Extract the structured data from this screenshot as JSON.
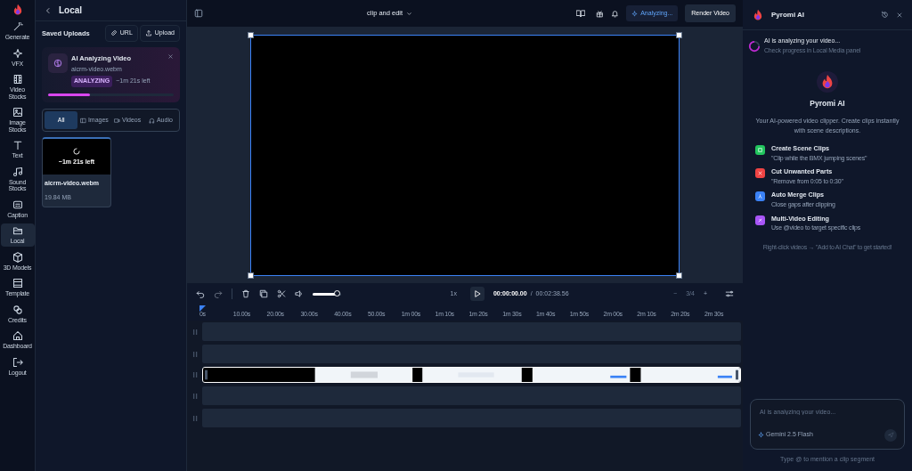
{
  "rail": {
    "items": [
      {
        "label": "Generate",
        "selected": false
      },
      {
        "label": "VFX",
        "selected": false
      },
      {
        "label": "Video Stocks",
        "selected": false
      },
      {
        "label": "Image Stocks",
        "selected": false
      },
      {
        "label": "Text",
        "selected": false
      },
      {
        "label": "Sound Stocks",
        "selected": false
      },
      {
        "label": "Caption",
        "selected": false
      },
      {
        "label": "Local",
        "selected": true
      },
      {
        "label": "3D Models",
        "selected": false
      },
      {
        "label": "Template",
        "selected": false
      },
      {
        "label": "Credits",
        "selected": false
      },
      {
        "label": "Dashboard",
        "selected": false
      },
      {
        "label": "Logout",
        "selected": false
      }
    ]
  },
  "panel": {
    "title": "Local",
    "section": "Saved Uploads",
    "buttons": [
      "URL",
      "Upload"
    ],
    "analysis": {
      "title": "AI Analyzing Video",
      "file": "aicrm-video.webm",
      "badge": "ANALYZING",
      "remaining": "~1m 21s left",
      "level": 0.33
    },
    "filters": [
      {
        "label": "All",
        "selected": true
      },
      {
        "label": "Images",
        "selected": false
      },
      {
        "label": "Videos",
        "selected": false
      },
      {
        "label": "Audio",
        "selected": false
      }
    ],
    "media": [
      {
        "name": "aicrm-video.webm",
        "size": "19.84 MB",
        "overlay": "~1m 21s left",
        "selected": true
      }
    ]
  },
  "header": {
    "project": "clip and edit",
    "status": "Analyzing...",
    "render": "Render Video"
  },
  "controls": {
    "volume": {
      "level": 0.85
    },
    "speed": "1x",
    "time": "00:00:00.00",
    "separator": "/",
    "duration": "00:02:38.56",
    "zoom_out": "−",
    "zoom": "3/4",
    "zoom_in": "+"
  },
  "ruler": [
    "0s",
    "10.00s",
    "20.00s",
    "30.00s",
    "40.00s",
    "50.00s",
    "1m 00s",
    "1m 10s",
    "1m 20s",
    "1m 30s",
    "1m 40s",
    "1m 50s",
    "2m 00s",
    "2m 10s",
    "2m 20s",
    "2m 30s"
  ],
  "tracks": [
    {
      "kind": "empty"
    },
    {
      "kind": "empty"
    },
    {
      "kind": "clip"
    },
    {
      "kind": "empty"
    },
    {
      "kind": "empty"
    }
  ],
  "assistant": {
    "title": "Pyromi AI",
    "notice": {
      "title": "AI is analyzing your video...",
      "subtitle": "Check progress in Local Media panel"
    },
    "name": "Pyromi AI",
    "intro": "Your AI-powered video clipper. Create clips instantly with scene descriptions.",
    "features": [
      {
        "title": "Create Scene Clips",
        "example": "\"Clip while the BMX jumping scenes\"",
        "color": "#22c55e"
      },
      {
        "title": "Cut Unwanted Parts",
        "example": "\"Remove from 0:05 to 0:30\"",
        "color": "#ef4444"
      },
      {
        "title": "Auto Merge Clips",
        "example": "Close gaps after clipping",
        "color": "#3b82f6"
      },
      {
        "title": "Multi-Video Editing",
        "example": "Use @video to target specific clips",
        "color": "#a855f7"
      }
    ],
    "hint": "Right-click videos → \"Add to AI Chat\" to get started!",
    "input": {
      "placeholder": "AI is analyzing your video..."
    },
    "model": "Gemini 2.5 Flash",
    "footer": "Type @ to mention a clip segment"
  }
}
